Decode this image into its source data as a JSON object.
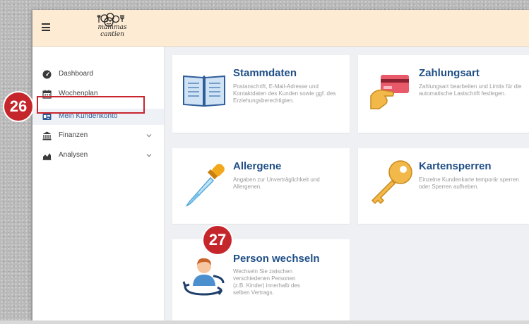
{
  "brand": {
    "logo_text_line1": "mammas",
    "logo_text_line2": "cantien"
  },
  "sidebar": {
    "items": [
      {
        "label": "Dashboard",
        "icon": "dashboard-icon"
      },
      {
        "label": "Wochenplan",
        "icon": "calendar-icon"
      },
      {
        "label": "Mein Kundenkonto",
        "icon": "id-card-icon",
        "active": true
      },
      {
        "label": "Finanzen",
        "icon": "bank-icon",
        "expandable": true
      },
      {
        "label": "Analysen",
        "icon": "area-chart-icon",
        "expandable": true
      }
    ]
  },
  "cards": [
    {
      "title": "Stammdaten",
      "description": "Postanschrift, E-Mail-Adresse und Kontaktdaten des Kunden sowie ggf. des Erziehungsberechtigten.",
      "icon": "book-icon"
    },
    {
      "title": "Zahlungsart",
      "description": "Zahlungsart bearbeiten und Limits für die automatische Lastschrift festlegen.",
      "icon": "credit-card-icon"
    },
    {
      "title": "Allergene",
      "description": "Angaben zur Unverträglichkeit und Allergenen.",
      "icon": "pipette-icon"
    },
    {
      "title": "Kartensperren",
      "description": "Einzelne Kundenkarte temporär sperren oder Sperren aufheben.",
      "icon": "key-icon"
    },
    {
      "title": "Person wechseln",
      "description": "Wechseln Sie zwischen verschiedenen Personen (z.B. Kinder) innerhalb des selben Vertrags.",
      "icon": "person-switch-icon"
    }
  ],
  "annotations": {
    "marker_26": "26",
    "marker_27": "27"
  },
  "colors": {
    "accent": "#1f4f86",
    "topbar": "#fdebd3",
    "marker": "#c4262b",
    "content_bg": "#eef0f3"
  }
}
